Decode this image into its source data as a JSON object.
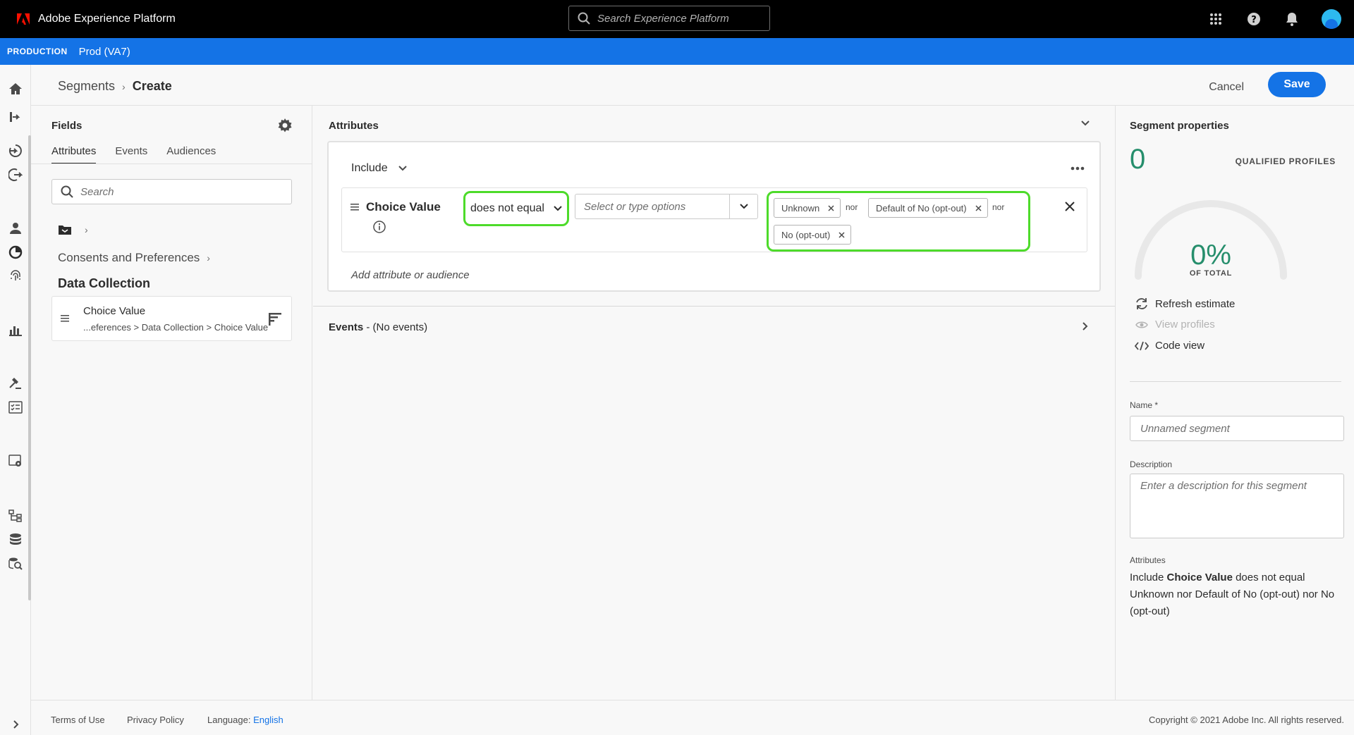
{
  "app": {
    "title": "Adobe Experience Platform"
  },
  "topbar": {
    "search_placeholder": "Search Experience Platform"
  },
  "sandbox": {
    "label": "PRODUCTION",
    "name": "Prod (VA7)"
  },
  "breadcrumb": {
    "parent": "Segments",
    "current": "Create"
  },
  "actions": {
    "cancel": "Cancel",
    "save": "Save"
  },
  "fields_panel": {
    "title": "Fields",
    "tabs": [
      "Attributes",
      "Events",
      "Audiences"
    ],
    "active_tab": "Attributes",
    "search_placeholder": "Search",
    "path_item": "Consents and Preferences",
    "group": "Data Collection",
    "field": {
      "name": "Choice Value",
      "path": "...eferences > Data Collection > Choice Value"
    }
  },
  "builder": {
    "attributes_title": "Attributes",
    "include_label": "Include",
    "rule": {
      "field": "Choice Value",
      "operator": "does not equal",
      "options_placeholder": "Select or type options",
      "values": [
        "Unknown",
        "Default of No (opt-out)",
        "No (opt-out)"
      ],
      "connector": "nor"
    },
    "add_placeholder": "Add attribute or audience",
    "events_title": "Events",
    "events_status": " - (No events)"
  },
  "properties": {
    "title": "Segment properties",
    "count": "0",
    "count_label": "QUALIFIED PROFILES",
    "percent": "0%",
    "percent_label": "OF TOTAL",
    "percent_value": 0,
    "refresh": "Refresh estimate",
    "view_profiles": "View profiles",
    "code_view": "Code view",
    "name_label": "Name *",
    "name_placeholder": "Unnamed segment",
    "description_label": "Description",
    "description_placeholder": "Enter a description for this segment",
    "attributes_label": "Attributes",
    "summary": {
      "include": "Include ",
      "field": "Choice Value",
      "rest": " does not equal Unknown nor Default of No (opt-out) nor No (opt-out)"
    }
  },
  "footer": {
    "terms": "Terms of Use",
    "privacy": "Privacy Policy",
    "language_label": "Language: ",
    "language_value": "English",
    "copyright": "Copyright ©  2021 Adobe Inc.  All rights reserved."
  },
  "colors": {
    "accent": "#1473e6",
    "highlight": "#4ddb2a",
    "success": "#268e6c",
    "topbar": "#000000"
  }
}
